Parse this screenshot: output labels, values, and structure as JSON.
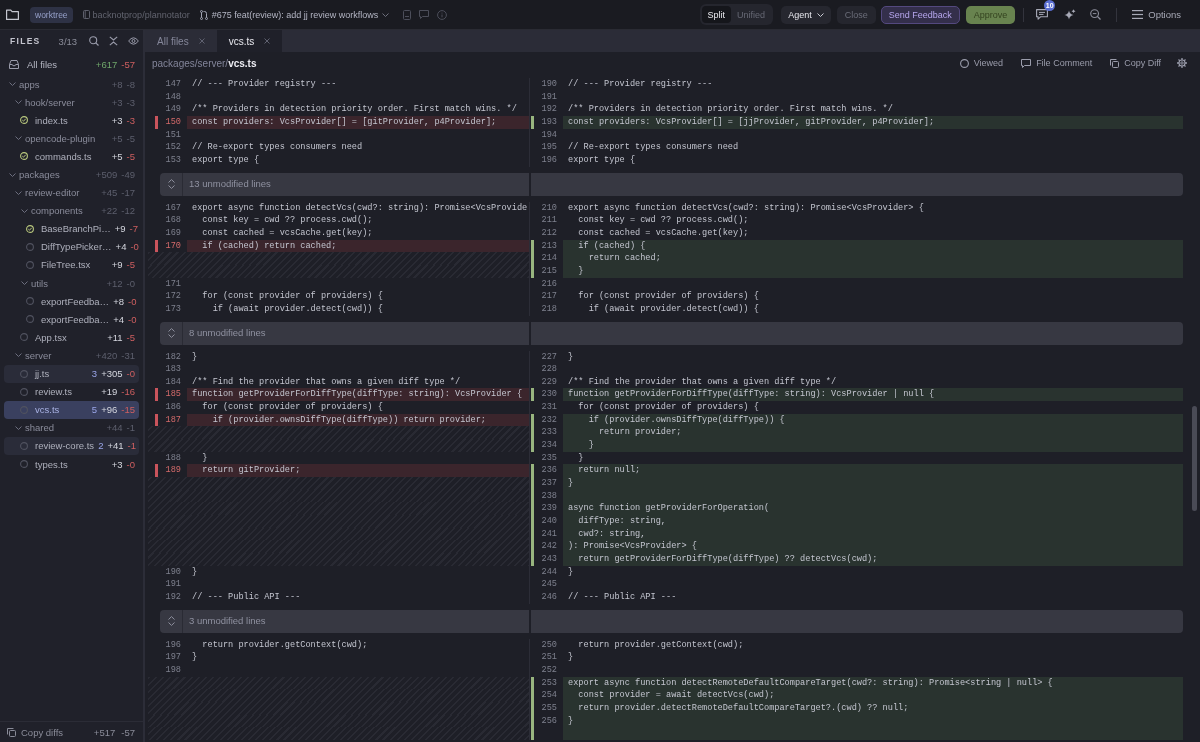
{
  "topbar": {
    "worktree_badge": "worktree",
    "repo": "backnotprop/plannotator",
    "pr_title": "#675 feat(review): add jj review workflows",
    "view_modes": [
      {
        "label": "Split",
        "selected": true
      },
      {
        "label": "Unified",
        "selected": false
      }
    ],
    "agent_button": "Agent",
    "close_button": "Close",
    "feedback_button": "Send Feedback",
    "approve_button": "Approve",
    "comments_badge": "10",
    "options_button": "Options"
  },
  "sidebar": {
    "title": "FILES",
    "count": "3/13",
    "all_files": {
      "label": "All files",
      "added": "+617",
      "removed": "-57"
    },
    "tree": [
      {
        "kind": "folder",
        "name": "apps",
        "added": "+8",
        "removed": "-8",
        "expanded": true,
        "selected": false,
        "children": [
          {
            "kind": "folder",
            "name": "hook/server",
            "added": "+3",
            "removed": "-3",
            "expanded": true,
            "selected": false,
            "children": [
              {
                "kind": "file",
                "name": "index.ts",
                "viewed": true,
                "selected": false,
                "added": "+3",
                "removed": "-3"
              }
            ]
          },
          {
            "kind": "folder",
            "name": "opencode-plugin",
            "added": "+5",
            "removed": "-5",
            "expanded": true,
            "selected": false,
            "children": [
              {
                "kind": "file",
                "name": "commands.ts",
                "viewed": true,
                "selected": false,
                "added": "+5",
                "removed": "-5"
              }
            ]
          }
        ]
      },
      {
        "kind": "folder",
        "name": "packages",
        "added": "+509",
        "removed": "-49",
        "expanded": true,
        "selected": false,
        "children": [
          {
            "kind": "folder",
            "name": "review-editor",
            "added": "+45",
            "removed": "-17",
            "expanded": true,
            "selected": false,
            "children": [
              {
                "kind": "folder",
                "name": "components",
                "added": "+22",
                "removed": "-12",
                "expanded": true,
                "selected": false,
                "children": [
                  {
                    "kind": "file",
                    "name": "BaseBranchPi…",
                    "viewed": true,
                    "selected": false,
                    "added": "+9",
                    "removed": "-7"
                  },
                  {
                    "kind": "file",
                    "name": "DiffTypePicker…",
                    "viewed": false,
                    "selected": false,
                    "added": "+4",
                    "removed": "-0"
                  },
                  {
                    "kind": "file",
                    "name": "FileTree.tsx",
                    "viewed": false,
                    "selected": false,
                    "added": "+9",
                    "removed": "-5"
                  }
                ]
              },
              {
                "kind": "folder",
                "name": "utils",
                "added": "+12",
                "removed": "-0",
                "expanded": true,
                "selected": false,
                "children": [
                  {
                    "kind": "file",
                    "name": "exportFeedba…",
                    "viewed": false,
                    "selected": false,
                    "added": "+8",
                    "removed": "-0"
                  },
                  {
                    "kind": "file",
                    "name": "exportFeedba…",
                    "viewed": false,
                    "selected": false,
                    "added": "+4",
                    "removed": "-0"
                  }
                ]
              },
              {
                "kind": "file",
                "name": "App.tsx",
                "viewed": false,
                "selected": false,
                "added": "+11",
                "removed": "-5"
              }
            ]
          },
          {
            "kind": "folder",
            "name": "server",
            "added": "+420",
            "removed": "-31",
            "expanded": true,
            "selected": false,
            "children": [
              {
                "kind": "file",
                "name": "jj.ts",
                "viewed": false,
                "selected": false,
                "comments": "3",
                "added": "+305",
                "removed": "-0"
              },
              {
                "kind": "file",
                "name": "review.ts",
                "viewed": false,
                "selected": false,
                "added": "+19",
                "removed": "-16"
              },
              {
                "kind": "file",
                "name": "vcs.ts",
                "viewed": false,
                "selected": true,
                "comments": "5",
                "added": "+96",
                "removed": "-15"
              }
            ]
          },
          {
            "kind": "folder",
            "name": "shared",
            "added": "+44",
            "removed": "-1",
            "expanded": true,
            "selected": false,
            "children": [
              {
                "kind": "file",
                "name": "review-core.ts",
                "viewed": false,
                "selected": false,
                "comments": "2",
                "added": "+41",
                "removed": "-1"
              },
              {
                "kind": "file",
                "name": "types.ts",
                "viewed": false,
                "selected": false,
                "added": "+3",
                "removed": "-0"
              }
            ]
          }
        ]
      }
    ],
    "footer": {
      "label": "Copy diffs",
      "added": "+517",
      "removed": "-57"
    }
  },
  "tabs": [
    {
      "label": "All files",
      "selected": false
    },
    {
      "label": "vcs.ts",
      "selected": true
    }
  ],
  "file_header": {
    "path": "packages/server/**vcs.ts**",
    "viewed_label": "Viewed",
    "viewed": false,
    "comment_label": "File Comment",
    "copy_label": "Copy Diff"
  },
  "diff": [
    {
      "kind": "row",
      "left": {
        "kind": "context",
        "num": "147",
        "code": "// --- Provider registry ---"
      },
      "right": {
        "kind": "context",
        "num": "190",
        "code": "// --- Provider registry ---"
      }
    },
    {
      "kind": "row",
      "left": {
        "kind": "context",
        "num": "148"
      },
      "right": {
        "kind": "context",
        "num": "191"
      }
    },
    {
      "kind": "row",
      "left": {
        "kind": "context",
        "num": "149",
        "code": "/** Providers in detection priority order. First match wins. */"
      },
      "right": {
        "kind": "context",
        "num": "192",
        "code": "/** Providers in detection priority order. First match wins. */"
      }
    },
    {
      "kind": "row",
      "left": {
        "kind": "deleted",
        "num": "150",
        "code": "const providers: VcsProvider[] = [gitProvider, p4Provider];"
      },
      "right": {
        "kind": "added",
        "num": "193",
        "code": "const providers: VcsProvider[] = [jjProvider, gitProvider, p4Provider];"
      }
    },
    {
      "kind": "row",
      "left": {
        "kind": "context",
        "num": "151"
      },
      "right": {
        "kind": "context",
        "num": "194"
      }
    },
    {
      "kind": "row",
      "left": {
        "kind": "context",
        "num": "152",
        "code": "// Re-export types consumers need"
      },
      "right": {
        "kind": "context",
        "num": "195",
        "code": "// Re-export types consumers need"
      }
    },
    {
      "kind": "row",
      "left": {
        "kind": "context",
        "num": "153",
        "code": "export type {"
      },
      "right": {
        "kind": "context",
        "num": "196",
        "code": "export type {"
      }
    },
    {
      "kind": "fold",
      "label": "13 unmodified lines"
    },
    {
      "kind": "row",
      "left": {
        "kind": "context",
        "num": "167",
        "code": "export async function detectVcs(cwd?: string): Promise<VcsProvide"
      },
      "right": {
        "kind": "context",
        "num": "210",
        "code": "export async function detectVcs(cwd?: string): Promise<VcsProvider> {"
      }
    },
    {
      "kind": "row",
      "left": {
        "kind": "context",
        "num": "168",
        "code": "  const key = cwd ?? process.cwd();"
      },
      "right": {
        "kind": "context",
        "num": "211",
        "code": "  const key = cwd ?? process.cwd();"
      }
    },
    {
      "kind": "row",
      "left": {
        "kind": "context",
        "num": "169",
        "code": "  const cached = vcsCache.get(key);"
      },
      "right": {
        "kind": "context",
        "num": "212",
        "code": "  const cached = vcsCache.get(key);"
      }
    },
    {
      "kind": "row",
      "left": {
        "kind": "deleted",
        "num": "170",
        "code": "  if (cached) return cached;"
      },
      "right": {
        "kind": "added",
        "num": "213",
        "code": "  if (cached) {"
      }
    },
    {
      "kind": "row",
      "left": {
        "kind": "gap"
      },
      "right": {
        "kind": "added",
        "num": "214",
        "code": "    return cached;"
      }
    },
    {
      "kind": "row",
      "left": {
        "kind": "gap"
      },
      "right": {
        "kind": "added",
        "num": "215",
        "code": "  }"
      }
    },
    {
      "kind": "row",
      "left": {
        "kind": "context",
        "num": "171"
      },
      "right": {
        "kind": "context",
        "num": "216"
      }
    },
    {
      "kind": "row",
      "left": {
        "kind": "context",
        "num": "172",
        "code": "  for (const provider of providers) {"
      },
      "right": {
        "kind": "context",
        "num": "217",
        "code": "  for (const provider of providers) {"
      }
    },
    {
      "kind": "row",
      "left": {
        "kind": "context",
        "num": "173",
        "code": "    if (await provider.detect(cwd)) {"
      },
      "right": {
        "kind": "context",
        "num": "218",
        "code": "    if (await provider.detect(cwd)) {"
      }
    },
    {
      "kind": "fold",
      "label": "8 unmodified lines"
    },
    {
      "kind": "row",
      "left": {
        "kind": "context",
        "num": "182",
        "code": "}"
      },
      "right": {
        "kind": "context",
        "num": "227",
        "code": "}"
      }
    },
    {
      "kind": "row",
      "left": {
        "kind": "context",
        "num": "183"
      },
      "right": {
        "kind": "context",
        "num": "228"
      }
    },
    {
      "kind": "row",
      "left": {
        "kind": "context",
        "num": "184",
        "code": "/** Find the provider that owns a given diff type */"
      },
      "right": {
        "kind": "context",
        "num": "229",
        "code": "/** Find the provider that owns a given diff type */"
      }
    },
    {
      "kind": "row",
      "left": {
        "kind": "deleted",
        "num": "185",
        "code": "function getProviderForDiffType(diffType: string): VcsProvider {"
      },
      "right": {
        "kind": "added",
        "num": "230",
        "code": "function getProviderForDiffType(diffType: string): VcsProvider | null {"
      }
    },
    {
      "kind": "row",
      "left": {
        "kind": "context",
        "num": "186",
        "code": "  for (const provider of providers) {"
      },
      "right": {
        "kind": "context",
        "num": "231",
        "code": "  for (const provider of providers) {"
      }
    },
    {
      "kind": "row",
      "left": {
        "kind": "deleted",
        "num": "187",
        "code": "    if (provider.ownsDiffType(diffType)) return provider;"
      },
      "right": {
        "kind": "added",
        "num": "232",
        "code": "    if (provider.ownsDiffType(diffType)) {"
      }
    },
    {
      "kind": "row",
      "left": {
        "kind": "gap"
      },
      "right": {
        "kind": "added",
        "num": "233",
        "code": "      return provider;"
      }
    },
    {
      "kind": "row",
      "left": {
        "kind": "gap"
      },
      "right": {
        "kind": "added",
        "num": "234",
        "code": "    }"
      }
    },
    {
      "kind": "row",
      "left": {
        "kind": "context",
        "num": "188",
        "code": "  }"
      },
      "right": {
        "kind": "context",
        "num": "235",
        "code": "  }"
      }
    },
    {
      "kind": "row",
      "left": {
        "kind": "deleted",
        "num": "189",
        "code": "  return gitProvider;"
      },
      "right": {
        "kind": "added",
        "num": "236",
        "code": "  return null;"
      }
    },
    {
      "kind": "row",
      "left": {
        "kind": "gap"
      },
      "right": {
        "kind": "added",
        "num": "237",
        "code": "}"
      }
    },
    {
      "kind": "row",
      "left": {
        "kind": "gap"
      },
      "right": {
        "kind": "added",
        "num": "238"
      }
    },
    {
      "kind": "row",
      "left": {
        "kind": "gap"
      },
      "right": {
        "kind": "added",
        "num": "239",
        "code": "async function getProviderForOperation("
      }
    },
    {
      "kind": "row",
      "left": {
        "kind": "gap"
      },
      "right": {
        "kind": "added",
        "num": "240",
        "code": "  diffType: string,"
      }
    },
    {
      "kind": "row",
      "left": {
        "kind": "gap"
      },
      "right": {
        "kind": "added",
        "num": "241",
        "code": "  cwd?: string,"
      }
    },
    {
      "kind": "row",
      "left": {
        "kind": "gap"
      },
      "right": {
        "kind": "added",
        "num": "242",
        "code": "): Promise<VcsProvider> {"
      }
    },
    {
      "kind": "row",
      "left": {
        "kind": "gap"
      },
      "right": {
        "kind": "added",
        "num": "243",
        "code": "  return getProviderForDiffType(diffType) ?? detectVcs(cwd);"
      }
    },
    {
      "kind": "row",
      "left": {
        "kind": "context",
        "num": "190",
        "code": "}"
      },
      "right": {
        "kind": "context",
        "num": "244",
        "code": "}"
      }
    },
    {
      "kind": "row",
      "left": {
        "kind": "context",
        "num": "191"
      },
      "right": {
        "kind": "context",
        "num": "245"
      }
    },
    {
      "kind": "row",
      "left": {
        "kind": "context",
        "num": "192",
        "code": "// --- Public API ---"
      },
      "right": {
        "kind": "context",
        "num": "246",
        "code": "// --- Public API ---"
      }
    },
    {
      "kind": "fold",
      "label": "3 unmodified lines"
    },
    {
      "kind": "row",
      "left": {
        "kind": "context",
        "num": "196",
        "code": "  return provider.getContext(cwd);"
      },
      "right": {
        "kind": "context",
        "num": "250",
        "code": "  return provider.getContext(cwd);"
      }
    },
    {
      "kind": "row",
      "left": {
        "kind": "context",
        "num": "197",
        "code": "}"
      },
      "right": {
        "kind": "context",
        "num": "251",
        "code": "}"
      }
    },
    {
      "kind": "row",
      "left": {
        "kind": "context",
        "num": "198"
      },
      "right": {
        "kind": "context",
        "num": "252"
      }
    },
    {
      "kind": "row",
      "left": {
        "kind": "gap"
      },
      "right": {
        "kind": "added",
        "num": "253",
        "code": "export async function detectRemoteDefaultCompareTarget(cwd?: string): Promise<string | null> {"
      }
    },
    {
      "kind": "row",
      "left": {
        "kind": "gap"
      },
      "right": {
        "kind": "added",
        "num": "254",
        "code": "  const provider = await detectVcs(cwd);"
      }
    },
    {
      "kind": "row",
      "left": {
        "kind": "gap"
      },
      "right": {
        "kind": "added",
        "num": "255",
        "code": "  return provider.detectRemoteDefaultCompareTarget?.(cwd) ?? null;"
      }
    },
    {
      "kind": "row",
      "left": {
        "kind": "gap"
      },
      "right": {
        "kind": "added",
        "num": "256",
        "code": "}"
      }
    },
    {
      "kind": "row",
      "left": {
        "kind": "gap"
      },
      "right": {
        "kind": "added"
      }
    }
  ]
}
